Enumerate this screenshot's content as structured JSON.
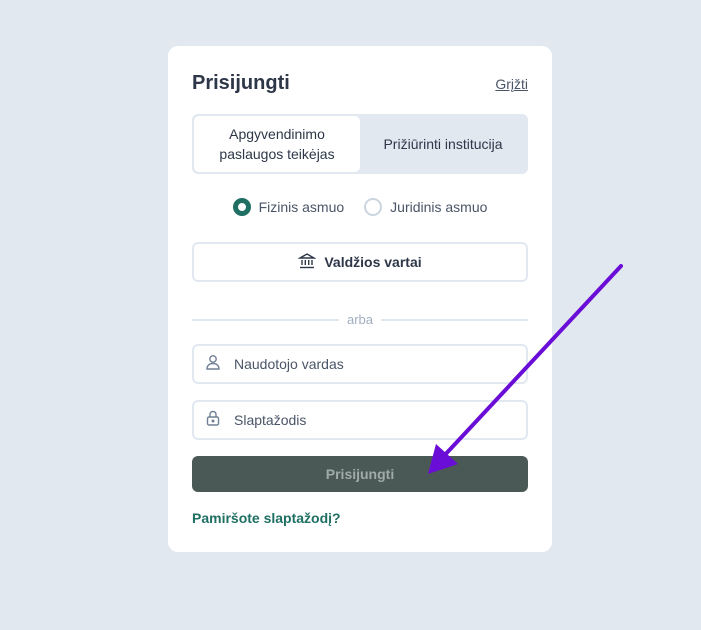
{
  "login": {
    "title": "Prisijungti",
    "back_label": "Grįžti",
    "tabs": [
      {
        "label": "Apgyvendinimo paslaugos teikėjas",
        "active": true
      },
      {
        "label": "Prižiūrinti institucija",
        "active": false
      }
    ],
    "person_types": [
      {
        "label": "Fizinis asmuo",
        "checked": true
      },
      {
        "label": "Juridinis asmuo",
        "checked": false
      }
    ],
    "gov_gateway_label": "Valdžios vartai",
    "divider_label": "arba",
    "username_placeholder": "Naudotojo vardas",
    "password_placeholder": "Slaptažodis",
    "submit_label": "Prisijungti",
    "forgot_label": "Pamiršote slaptažodį?"
  },
  "colors": {
    "background": "#e2e8f0",
    "brand": "#1f6f63",
    "submit_bg": "#4a5956",
    "annotation_arrow": "#6a0dd6"
  },
  "icons": {
    "gov_button": "bank-icon",
    "username": "user-icon",
    "password": "lock-icon"
  }
}
